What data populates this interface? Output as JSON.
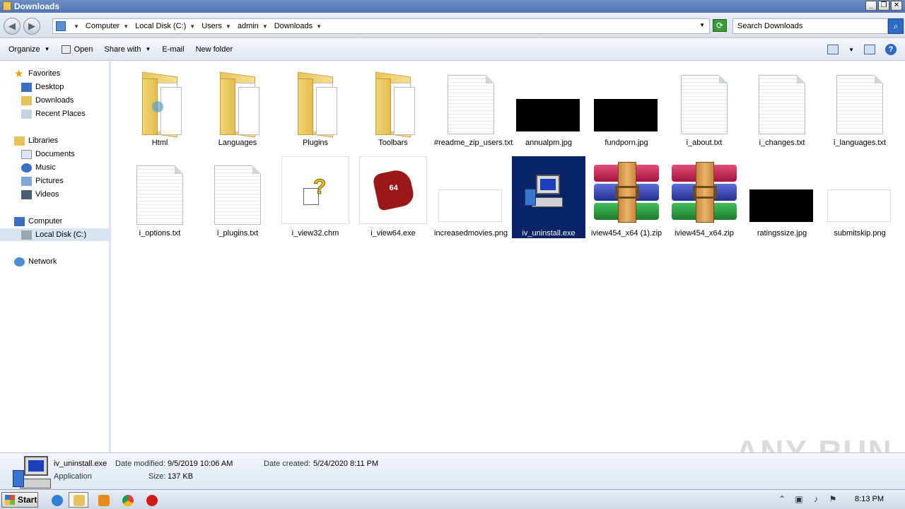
{
  "window": {
    "title": "Downloads",
    "buttons": [
      "_",
      "❐",
      "✕"
    ]
  },
  "address": {
    "crumbs": [
      "Computer",
      "Local Disk (C:)",
      "Users",
      "admin",
      "Downloads"
    ],
    "search_placeholder": "Search Downloads"
  },
  "toolbar": {
    "organize": "Organize",
    "open": "Open",
    "share": "Share with",
    "email": "E-mail",
    "new_folder": "New folder"
  },
  "sidebar": {
    "favorites": "Favorites",
    "desktop": "Desktop",
    "downloads": "Downloads",
    "recent": "Recent Places",
    "libraries": "Libraries",
    "documents": "Documents",
    "music": "Music",
    "pictures": "Pictures",
    "videos": "Videos",
    "computer": "Computer",
    "localdisk": "Local Disk (C:)",
    "network": "Network"
  },
  "files": {
    "f0": "Html",
    "f1": "Languages",
    "f2": "Plugins",
    "f3": "Toolbars",
    "f4": "#readme_zip_users.txt",
    "f5": "annualpm.jpg",
    "f6": "fundporn.jpg",
    "f7": "i_about.txt",
    "f8": "i_changes.txt",
    "f9": "i_languages.txt",
    "f10": "i_options.txt",
    "f11": "i_plugins.txt",
    "f12": "i_view32.chm",
    "f13": "i_view64.exe",
    "f14": "increasedmovies.png",
    "f15": "iv_uninstall.exe",
    "f16": "iview454_x64 (1).zip",
    "f17": "iview454_x64.zip",
    "f18": "ratingssize.jpg",
    "f19": "submitskip.png"
  },
  "details": {
    "name": "iv_uninstall.exe",
    "type": "Application",
    "modified_label": "Date modified:",
    "modified": "9/5/2019 10:06 AM",
    "size_label": "Size:",
    "size": "137 KB",
    "created_label": "Date created:",
    "created": "5/24/2020 8:11 PM"
  },
  "watermark": "ANY RUN",
  "taskbar": {
    "start": "Start",
    "clock": "8:13 PM"
  }
}
